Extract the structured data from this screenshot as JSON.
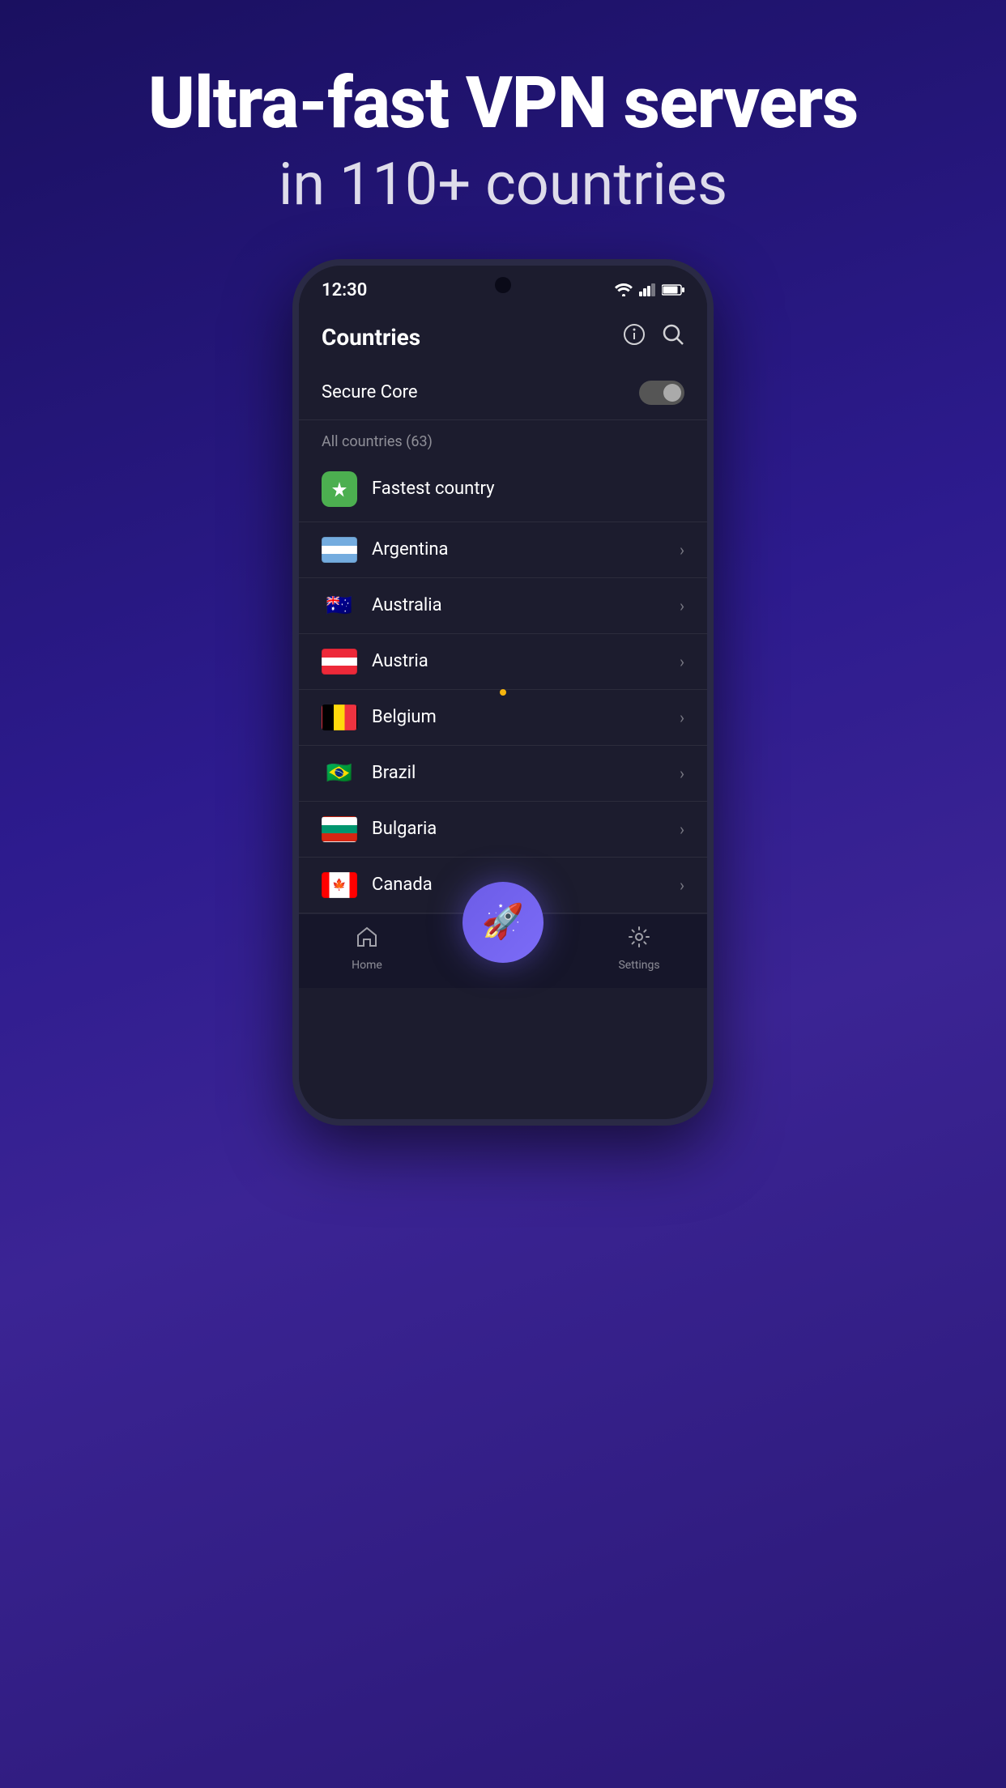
{
  "hero": {
    "title": "Ultra-fast VPN servers",
    "subtitle": "in 110+ countries"
  },
  "status_bar": {
    "time": "12:30",
    "wifi_icon": "▼",
    "signal_icon": "▲",
    "battery_icon": "▮"
  },
  "app": {
    "title": "Countries",
    "info_icon": "ℹ",
    "search_icon": "⌕"
  },
  "secure_core": {
    "label": "Secure Core",
    "toggle_state": "off"
  },
  "countries_section": {
    "label": "All countries (63)"
  },
  "country_items": [
    {
      "name": "Fastest country",
      "type": "fastest"
    },
    {
      "name": "Argentina",
      "type": "country",
      "flag": "argentina"
    },
    {
      "name": "Australia",
      "type": "country",
      "flag": "australia"
    },
    {
      "name": "Austria",
      "type": "country",
      "flag": "austria"
    },
    {
      "name": "Belgium",
      "type": "country",
      "flag": "belgium"
    },
    {
      "name": "Brazil",
      "type": "country",
      "flag": "brazil"
    },
    {
      "name": "Bulgaria",
      "type": "country",
      "flag": "bulgaria"
    },
    {
      "name": "Canada",
      "type": "country",
      "flag": "canada"
    }
  ],
  "bottom_nav": {
    "home_label": "Home",
    "connect_icon": "🚀",
    "settings_label": "Settings"
  }
}
